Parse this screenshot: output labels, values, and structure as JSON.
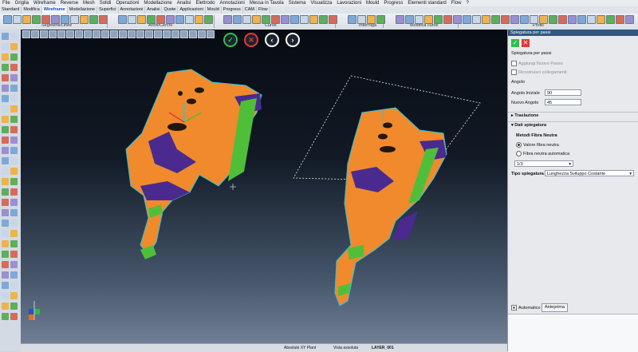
{
  "menu": [
    "File",
    "Griglia",
    "Wireframe",
    "Reverse",
    "Mesh",
    "Solidi",
    "Operazioni",
    "Modellazione",
    "Analisi",
    "Elettrodo",
    "Annotazioni",
    "Messa in Tavola",
    "Sistema",
    "Visualizza",
    "Lavorazioni",
    "Mould",
    "Progress",
    "Elementi standard",
    "Flow",
    "?"
  ],
  "tabs": [
    "Standard",
    "Modifica",
    "Wireframe",
    "Modellazione",
    "Superfici",
    "Annotazioni",
    "Analisi",
    "Quote",
    "Applicazioni",
    "Mould",
    "Progress",
    "CAM",
    "Flow"
  ],
  "active_tab": "Wireframe",
  "ribbon_groups": [
    "Segmenti/Linee",
    "Archi/Cerchi",
    "Curve",
    "Interroga",
    "Modifica curve",
    "Profili"
  ],
  "panel": {
    "title": "Spiegatura per passi",
    "section_steps": "Spiegatura per passi",
    "add_step": "Aggiungi Nuovo Passo",
    "rebuild_links": "Ricostruisci collegamenti",
    "angle_section": "Angolo",
    "start_angle_label": "Angolo Iniziale",
    "start_angle_value": "90",
    "new_angle_label": "Nuovo Angolo",
    "new_angle_value": "45",
    "translation_section": "Traslazione",
    "unfold_data_section": "Dati spiegatura",
    "neutral_method_label": "Metodi Fibra Neutra",
    "neutral_value_option": "Valore fibra neutra",
    "neutral_auto_option": "Fibra neutra automatica",
    "ratio_value": "1/3",
    "unfold_type_label": "Tipo spiegatura",
    "unfold_type_value": "Lunghezza Sviluppo Costante",
    "automatic_label": "Automatico",
    "preview_label": "Anteprima"
  },
  "status": {
    "plane": "Absolute XY Plant",
    "view": "Vista assoluta",
    "layer": "LAYER_001"
  },
  "colors": {
    "part_orange": "#f08a2c",
    "part_purple": "#4a2a8f",
    "part_green": "#4fbf3a",
    "edge_cyan": "#29c6e0",
    "confirm_green": "#2fbf4a",
    "cancel_red": "#e23a3a"
  }
}
